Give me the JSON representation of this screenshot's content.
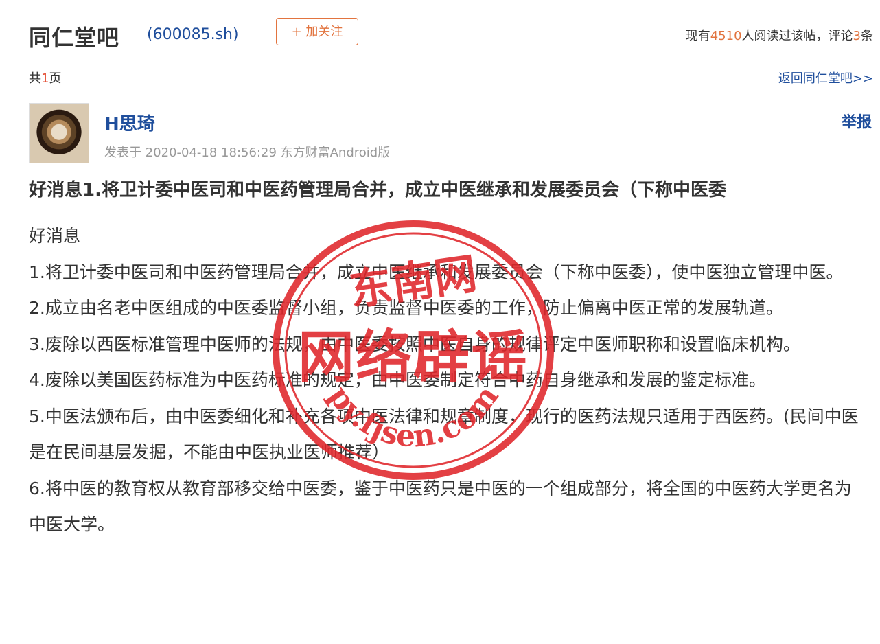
{
  "header": {
    "forum_name": "同仁堂吧",
    "stock_code": "(600085.sh)",
    "follow_label": "+ 加关注",
    "stats": {
      "prefix": "现有",
      "views": "4510",
      "middle": "人阅读过该帖，评论",
      "comments": "3",
      "suffix": "条"
    }
  },
  "pager": {
    "prefix": "共",
    "pages": "1",
    "suffix": "页"
  },
  "back_link": "返回同仁堂吧>>",
  "post": {
    "author": "H思琦",
    "meta": "发表于 2020-04-18 18:56:29 东方财富Android版",
    "report_label": "举报",
    "title": "好消息1.将卫计委中医司和中医药管理局合并，成立中医继承和发展委员会（下称中医委",
    "paragraphs": [
      "好消息",
      "1.将卫计委中医司和中医药管理局合并，成立中医继承和发展委员会（下称中医委），使中医独立管理中医。",
      "2.成立由名老中医组成的中医委监督小组，负责监督中医委的工作，防止偏离中医正常的发展轨道。",
      "3.废除以西医标准管理中医师的法规，由中医委按照中医自身的规律评定中医师职称和设置临床机构。",
      "4.废除以美国医药标准为中医药标准的规定，由中医委制定符合中药自身继承和发展的鉴定标准。",
      "5.中医法颁布后，由中医委细化和补充各项中医法律和规章制度，现行的医药法规只适用于西医药。(民间中医是在民间基层发掘，不能由中医执业医师推荐）",
      "6.将中医的教育权从教育部移交给中医委，鉴于中医药只是中医的一个组成部分，将全国的中医药大学更名为中医大学。"
    ]
  },
  "stamp": {
    "top_text": "东南网",
    "center_text": "网络辟谣",
    "bottom_text": "py.fjsen.com",
    "color": "#e0262b"
  },
  "colors": {
    "accent": "#e2743f",
    "link": "#1f4e9c",
    "muted": "#999999"
  }
}
